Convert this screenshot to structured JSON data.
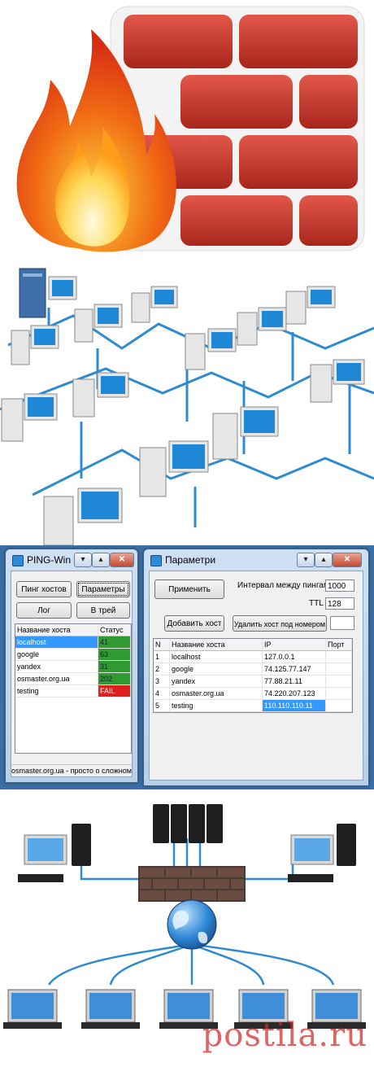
{
  "colors": {
    "brick": "#c8392a",
    "mortar": "#f2f2f2",
    "flame_outer": "#e8381a",
    "flame_inner": "#ffb21a",
    "cable": "#2e8bd0",
    "screen": "#1e88d6",
    "desktop_bg": "#3b6ea5",
    "ok_green": "#2f9a2f",
    "fail_red": "#e02020",
    "watermark": "#cd2828"
  },
  "ping_win": {
    "title": "PING-Win",
    "controls": [
      "▾",
      "▴",
      "✕"
    ],
    "buttons": {
      "ping_hosts": "Пинг хостов",
      "params": "Параметры",
      "log": "Лог",
      "tray": "В трей"
    },
    "table": {
      "headers": [
        "Название хоста",
        "Статус"
      ],
      "rows": [
        {
          "host": "localhost",
          "status": "41",
          "state": "ok"
        },
        {
          "host": "google",
          "status": "63",
          "state": "ok"
        },
        {
          "host": "yandex",
          "status": "31",
          "state": "ok"
        },
        {
          "host": "osmaster.org.ua",
          "status": "202",
          "state": "ok"
        },
        {
          "host": "testing",
          "status": "FAIL",
          "state": "fail"
        }
      ]
    },
    "statusbar": "osmaster.org.ua - просто о сложном"
  },
  "params_win": {
    "title": "Параметри",
    "controls": [
      "▾",
      "▴",
      "✕"
    ],
    "buttons": {
      "apply": "Применить",
      "add_host": "Добавить хост",
      "delete_host": "Удалить хост под номером"
    },
    "interval_label": "Интервал между пингами",
    "interval_value": "1000",
    "ttl_label": "TTL",
    "ttl_value": "128",
    "delete_value": "",
    "table": {
      "headers": [
        "N",
        "Название хоста",
        "IP",
        "Порт"
      ],
      "rows": [
        {
          "n": "1",
          "host": "localhost",
          "ip": "127.0.0.1",
          "port": ""
        },
        {
          "n": "2",
          "host": "google",
          "ip": "74.125.77.147",
          "port": ""
        },
        {
          "n": "3",
          "host": "yandex",
          "ip": "77.88.21.11",
          "port": ""
        },
        {
          "n": "4",
          "host": "osmaster.org.ua",
          "ip": "74.220.207.123",
          "port": ""
        },
        {
          "n": "5",
          "host": "testing",
          "ip": "110.110.110.11",
          "port": ""
        }
      ]
    }
  },
  "watermark": "postila.ru"
}
